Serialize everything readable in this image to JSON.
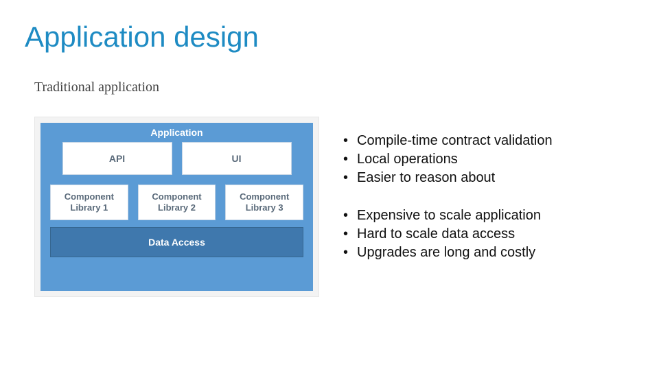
{
  "title": "Application design",
  "subtitle": "Traditional application",
  "diagram": {
    "header": "Application",
    "topRow": [
      "API",
      "UI"
    ],
    "midRow": [
      "Component Library 1",
      "Component Library 2",
      "Component Library 3"
    ],
    "bottom": "Data Access"
  },
  "bullets": {
    "pros": [
      "Compile-time contract validation",
      "Local operations",
      "Easier to reason about"
    ],
    "cons": [
      "Expensive to scale application",
      "Hard to scale data access",
      "Upgrades are long and costly"
    ]
  }
}
